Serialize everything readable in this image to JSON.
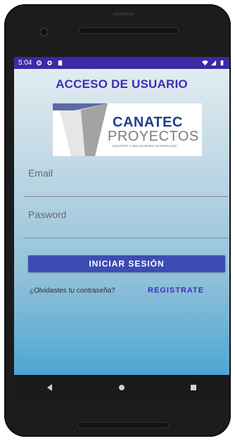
{
  "status_bar": {
    "time": "5:04",
    "icons_left": [
      "gear-icon",
      "shield-icon",
      "sd-card-icon"
    ],
    "icons_right": [
      "wifi-icon",
      "signal-icon",
      "battery-icon"
    ],
    "bar_color": "#3a2aa6"
  },
  "login": {
    "title": "ACCESO DE USUARIO",
    "logo": {
      "line1": "CANATEC",
      "line2": "PROYECTOS",
      "tagline": "EQUIPOS Y SOLUCIONES INTEGRALES"
    },
    "email_label": "Email",
    "email_value": "",
    "password_label": "Pasword",
    "password_value": "",
    "login_button": "INICIAR SESIÓN",
    "forgot_text": "¿Olvidastes tu contraseña?",
    "register_link": "REGISTRATE"
  },
  "navigation": {
    "buttons": [
      "back-icon",
      "home-icon",
      "recents-icon"
    ]
  },
  "colors": {
    "accent": "#3b2fb5",
    "button": "#3d4cb3"
  }
}
